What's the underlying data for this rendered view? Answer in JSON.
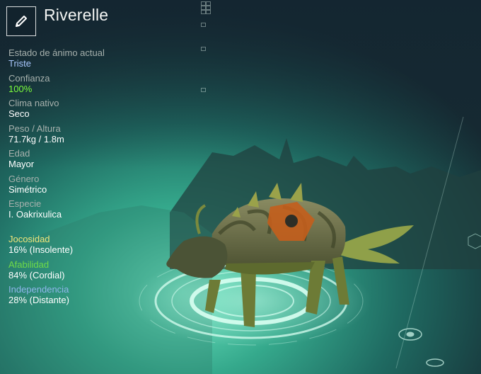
{
  "creature": {
    "name": "Riverelle"
  },
  "stats": [
    {
      "label": "Estado de ánimo actual",
      "value": "Triste",
      "value_color": "#a9c8ff"
    },
    {
      "label": "Confianza",
      "value": "100%",
      "value_color": "#7dff3c"
    },
    {
      "label": "Clima nativo",
      "value": "Seco",
      "value_color": "#ffffff"
    },
    {
      "label": "Peso / Altura",
      "value": "71.7kg / 1.8m",
      "value_color": "#ffffff"
    },
    {
      "label": "Edad",
      "value": "Mayor",
      "value_color": "#ffffff"
    },
    {
      "label": "Género",
      "value": "Simétrico",
      "value_color": "#ffffff"
    },
    {
      "label": "Especie",
      "value": "I. Oakrixulica",
      "value_color": "#ffffff"
    }
  ],
  "traits": [
    {
      "label": "Jocosidad",
      "value": "16% (Insolente)",
      "label_color": "#f0e57a"
    },
    {
      "label": "Afabilidad",
      "value": "84% (Cordial)",
      "label_color": "#6edb48"
    },
    {
      "label": "Independencia",
      "value": "28% (Distante)",
      "label_color": "#8fb6ec"
    }
  ],
  "icons": {
    "edit": "pencil-icon"
  },
  "colors": {
    "background_dark": "#1b2f33",
    "background_glow": "#3fbf9a",
    "ring_glow": "#c9fff0"
  }
}
